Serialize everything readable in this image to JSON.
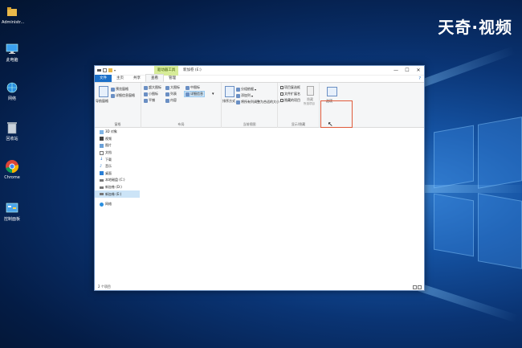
{
  "watermark": "天奇·视频",
  "desktop_icons": [
    {
      "label": "Administr...",
      "icon": "user-folder-icon"
    },
    {
      "label": "此电脑",
      "icon": "computer-icon"
    },
    {
      "label": "网络",
      "icon": "network-icon"
    },
    {
      "label": "回收站",
      "icon": "recycle-bin-icon"
    },
    {
      "label": "Chrome",
      "icon": "chrome-icon"
    },
    {
      "label": "控制面板",
      "icon": "control-panel-icon"
    }
  ],
  "window": {
    "context_tab": "驱动器工具",
    "title": "新加卷 (E:)",
    "controls": [
      "—",
      "☐",
      "✕"
    ]
  },
  "tabs": [
    "文件",
    "主页",
    "共享",
    "查看",
    "管理"
  ],
  "active_tab": "查看",
  "ribbon": {
    "panes": {
      "nav_pane": "导航窗格",
      "preview_pane": "预览窗格",
      "details_pane": "详细信息窗格",
      "label": "窗格"
    },
    "layout": {
      "items": [
        "超大图标",
        "大图标",
        "中图标",
        "小图标",
        "列表",
        "详细信息",
        "平铺",
        "内容"
      ],
      "label": "布局"
    },
    "current_view": {
      "sort": "排序方式",
      "group": "分组依据",
      "add_columns": "添加列",
      "fit_columns": "将所有列调整为合适的大小",
      "label": "当前视图"
    },
    "show_hide": {
      "item_checkboxes": "项目复选框",
      "extensions": "文件扩展名",
      "hidden_items": "隐藏的项目",
      "hide_selected": "隐藏",
      "hide_selected_sub": "所选项目",
      "label": "显示/隐藏"
    },
    "options": "选项"
  },
  "nav_items": [
    {
      "label": "3D 对象",
      "icon": "3d-objects-icon"
    },
    {
      "label": "视频",
      "icon": "video-icon"
    },
    {
      "label": "图片",
      "icon": "pictures-icon"
    },
    {
      "label": "文档",
      "icon": "documents-icon"
    },
    {
      "label": "下载",
      "icon": "download-icon"
    },
    {
      "label": "音乐",
      "icon": "music-icon"
    },
    {
      "label": "桌面",
      "icon": "desktop-icon"
    },
    {
      "label": "本地磁盘 (C:)",
      "icon": "drive-icon"
    },
    {
      "label": "新加卷 (D:)",
      "icon": "drive-icon"
    },
    {
      "label": "新加卷 (E:)",
      "icon": "drive-icon"
    },
    {
      "label": "网络",
      "icon": "network-icon"
    }
  ],
  "status": "2 个项目"
}
